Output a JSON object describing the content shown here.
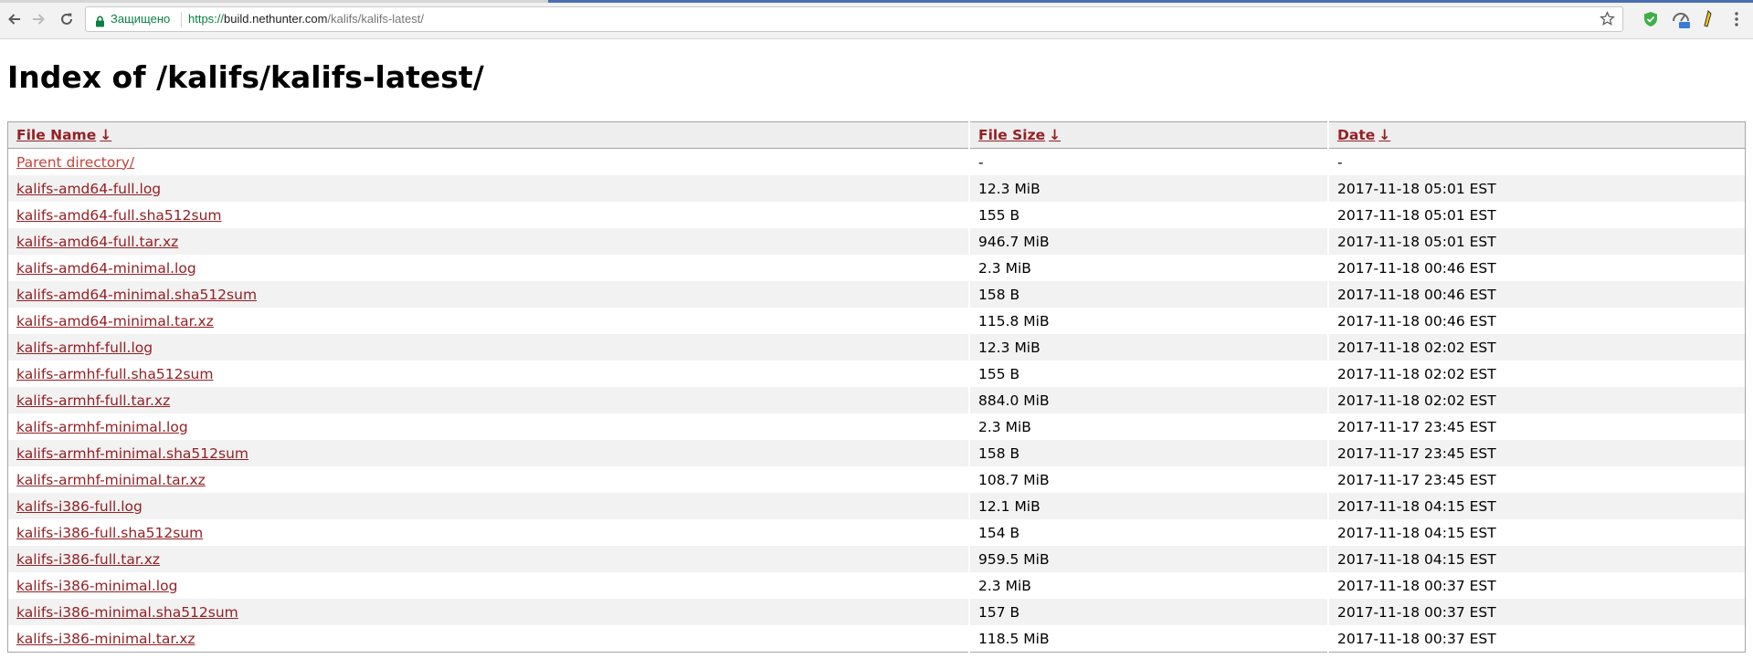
{
  "browser": {
    "secure_label": "Защищено",
    "url_scheme": "https://",
    "url_host": "build.nethunter.com",
    "url_path": "/kalifs/kalifs-latest/"
  },
  "page": {
    "title": "Index of /kalifs/kalifs-latest/"
  },
  "table": {
    "headers": {
      "name": "File Name",
      "size": "File Size",
      "date": "Date",
      "sort_arrow": "↓"
    },
    "rows": [
      {
        "name": "Parent directory/",
        "size": "-",
        "date": "-"
      },
      {
        "name": "kalifs-amd64-full.log",
        "size": "12.3 MiB",
        "date": "2017-11-18 05:01 EST"
      },
      {
        "name": "kalifs-amd64-full.sha512sum",
        "size": "155 B",
        "date": "2017-11-18 05:01 EST"
      },
      {
        "name": "kalifs-amd64-full.tar.xz",
        "size": "946.7 MiB",
        "date": "2017-11-18 05:01 EST"
      },
      {
        "name": "kalifs-amd64-minimal.log",
        "size": "2.3 MiB",
        "date": "2017-11-18 00:46 EST"
      },
      {
        "name": "kalifs-amd64-minimal.sha512sum",
        "size": "158 B",
        "date": "2017-11-18 00:46 EST"
      },
      {
        "name": "kalifs-amd64-minimal.tar.xz",
        "size": "115.8 MiB",
        "date": "2017-11-18 00:46 EST"
      },
      {
        "name": "kalifs-armhf-full.log",
        "size": "12.3 MiB",
        "date": "2017-11-18 02:02 EST"
      },
      {
        "name": "kalifs-armhf-full.sha512sum",
        "size": "155 B",
        "date": "2017-11-18 02:02 EST"
      },
      {
        "name": "kalifs-armhf-full.tar.xz",
        "size": "884.0 MiB",
        "date": "2017-11-18 02:02 EST"
      },
      {
        "name": "kalifs-armhf-minimal.log",
        "size": "2.3 MiB",
        "date": "2017-11-17 23:45 EST"
      },
      {
        "name": "kalifs-armhf-minimal.sha512sum",
        "size": "158 B",
        "date": "2017-11-17 23:45 EST"
      },
      {
        "name": "kalifs-armhf-minimal.tar.xz",
        "size": "108.7 MiB",
        "date": "2017-11-17 23:45 EST"
      },
      {
        "name": "kalifs-i386-full.log",
        "size": "12.1 MiB",
        "date": "2017-11-18 04:15 EST"
      },
      {
        "name": "kalifs-i386-full.sha512sum",
        "size": "154 B",
        "date": "2017-11-18 04:15 EST"
      },
      {
        "name": "kalifs-i386-full.tar.xz",
        "size": "959.5 MiB",
        "date": "2017-11-18 04:15 EST"
      },
      {
        "name": "kalifs-i386-minimal.log",
        "size": "2.3 MiB",
        "date": "2017-11-18 00:37 EST"
      },
      {
        "name": "kalifs-i386-minimal.sha512sum",
        "size": "157 B",
        "date": "2017-11-18 00:37 EST"
      },
      {
        "name": "kalifs-i386-minimal.tar.xz",
        "size": "118.5 MiB",
        "date": "2017-11-18 00:37 EST"
      }
    ]
  },
  "colors": {
    "link": "#942024",
    "secure": "#0b8043",
    "header_bg": "#eeeeee",
    "stripe_bg": "#f2f2f2"
  },
  "icons": [
    "back-icon",
    "forward-icon",
    "reload-icon",
    "lock-icon",
    "star-icon",
    "shield-extension-icon",
    "speed-extension-icon",
    "pencil-extension-icon",
    "menu-icon"
  ]
}
